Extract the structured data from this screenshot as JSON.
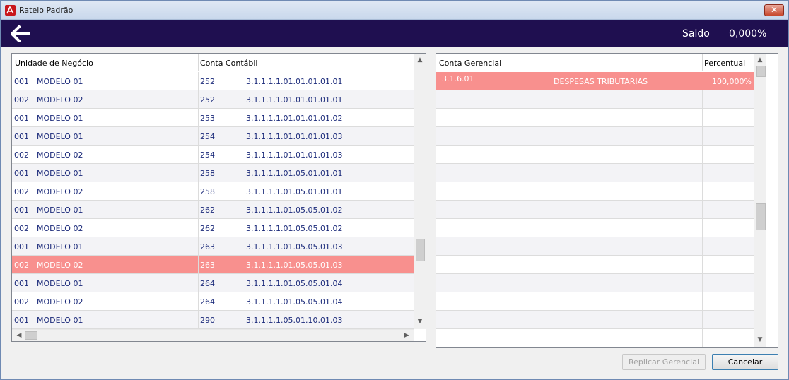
{
  "window": {
    "title": "Rateio Padrão",
    "close_symbol": "✕"
  },
  "header": {
    "saldo_label": "Saldo",
    "saldo_value": "0,000%"
  },
  "left_grid": {
    "columns": [
      "Unidade de Negócio",
      "Conta Contábil"
    ],
    "rows": [
      {
        "un_code": "001",
        "un_name": "MODELO 01",
        "acc_code": "252",
        "acc_num": "3.1.1.1.1.01.01.01.01.01"
      },
      {
        "un_code": "002",
        "un_name": "MODELO 02",
        "acc_code": "252",
        "acc_num": "3.1.1.1.1.01.01.01.01.01"
      },
      {
        "un_code": "001",
        "un_name": "MODELO 01",
        "acc_code": "253",
        "acc_num": "3.1.1.1.1.01.01.01.01.02"
      },
      {
        "un_code": "001",
        "un_name": "MODELO 01",
        "acc_code": "254",
        "acc_num": "3.1.1.1.1.01.01.01.01.03"
      },
      {
        "un_code": "002",
        "un_name": "MODELO 02",
        "acc_code": "254",
        "acc_num": "3.1.1.1.1.01.01.01.01.03"
      },
      {
        "un_code": "001",
        "un_name": "MODELO 01",
        "acc_code": "258",
        "acc_num": "3.1.1.1.1.01.05.01.01.01"
      },
      {
        "un_code": "002",
        "un_name": "MODELO 02",
        "acc_code": "258",
        "acc_num": "3.1.1.1.1.01.05.01.01.01"
      },
      {
        "un_code": "001",
        "un_name": "MODELO 01",
        "acc_code": "262",
        "acc_num": "3.1.1.1.1.01.05.05.01.02"
      },
      {
        "un_code": "002",
        "un_name": "MODELO 02",
        "acc_code": "262",
        "acc_num": "3.1.1.1.1.01.05.05.01.02"
      },
      {
        "un_code": "001",
        "un_name": "MODELO 01",
        "acc_code": "263",
        "acc_num": "3.1.1.1.1.01.05.05.01.03"
      },
      {
        "un_code": "002",
        "un_name": "MODELO 02",
        "acc_code": "263",
        "acc_num": "3.1.1.1.1.01.05.05.01.03",
        "selected": true
      },
      {
        "un_code": "001",
        "un_name": "MODELO 01",
        "acc_code": "264",
        "acc_num": "3.1.1.1.1.01.05.05.01.04"
      },
      {
        "un_code": "002",
        "un_name": "MODELO 02",
        "acc_code": "264",
        "acc_num": "3.1.1.1.1.01.05.05.01.04"
      },
      {
        "un_code": "001",
        "un_name": "MODELO 01",
        "acc_code": "290",
        "acc_num": "3.1.1.1.1.05.01.10.01.03"
      }
    ]
  },
  "right_grid": {
    "columns": [
      "Conta Gerencial",
      "Percentual"
    ],
    "rows": [
      {
        "code": "3.1.6.01",
        "name": "DESPESAS TRIBUTARIAS",
        "percent": "100,000%",
        "selected": true
      }
    ],
    "empty_rows": 14
  },
  "buttons": {
    "replicar": "Replicar Gerencial",
    "cancelar": "Cancelar"
  },
  "colors": {
    "header_bg": "#1f0f50",
    "selected_row": "#f8908e",
    "row_text": "#1b2a7a"
  }
}
